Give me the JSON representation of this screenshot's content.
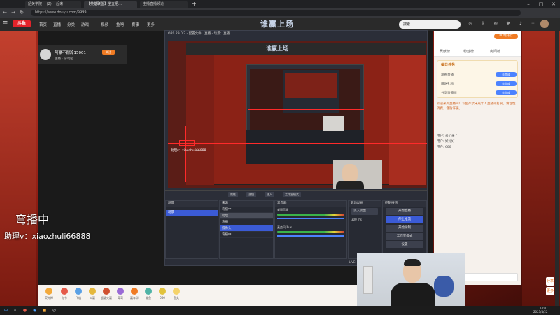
{
  "browser": {
    "tabs": [
      {
        "label": "韶关学院一 (2) 一起来"
      },
      {
        "label": "【英雄联盟】坐五把…"
      },
      {
        "label": "主播直播频道"
      }
    ],
    "url": "https://www.douyu.com/9999"
  },
  "site": {
    "logo": "斗鱼",
    "nav": [
      "首页",
      "直播",
      "分类",
      "游戏",
      "视频",
      "鱼吧",
      "赛事",
      "更多"
    ],
    "brand": "谁赢上场",
    "search_placeholder": "搜索",
    "rank_label": "PC端排行"
  },
  "streamer": {
    "title": "阿豪不耐冷15001",
    "nick": "主播 · 游戏区",
    "follow": "关注",
    "count": "12"
  },
  "overlay": {
    "line1": "弯播中",
    "line2": "助理v：xiaozhuli66888"
  },
  "obs": {
    "title": "OBS 29.0.2 - 配置文件：直播 - 场景：直播",
    "nested_text": "助理v：xiaozhuli66888",
    "toolbar": [
      "属性",
      "滤镜",
      "进入",
      "工作室模式"
    ],
    "docks": {
      "scenes": {
        "header": "场景",
        "items": [
          "场景"
        ]
      },
      "sources": {
        "header": "来源",
        "items": [
          "弯播中",
          "助理",
          "弯播",
          "摄像头",
          "弯播中"
        ]
      },
      "mixer": {
        "header": "混音器",
        "channels": [
          "桌面音频",
          "麦克风/Aux"
        ]
      },
      "transitions": {
        "header": "转场动画",
        "type": "淡入淡出",
        "duration": "300 ms"
      },
      "controls": {
        "header": "控制按钮",
        "buttons": [
          "开始直播",
          "停止推流",
          "开始录制",
          "工作室模式",
          "设置",
          "退出"
        ]
      }
    },
    "status": "LIVE: 00:00:00   REC: 00:00:00   CPU: 12.2%, 30.00 fps"
  },
  "chat": {
    "tabs": [
      "贡献榜",
      "粉丝榜",
      "房间榜"
    ],
    "task_title": "每日任务",
    "tasks": [
      {
        "label": "观看直播",
        "btn": "去完成"
      },
      {
        "label": "赠送礼物",
        "btn": "去完成"
      },
      {
        "label": "分享直播间",
        "btn": "去完成"
      }
    ],
    "messages": [
      "欢迎来到直播间！斗鱼严禁未成年人直播或打赏，请理性消费，谨防诈骗。",
      "用户: 来了来了",
      "用户: 好好好",
      "用户: 666"
    ],
    "side_buttons": [
      "分享",
      "更多"
    ]
  },
  "gifts": [
    "荧光棒",
    "办卡",
    "飞机",
    "火箭",
    "超级火箭",
    "弯弯",
    "嘉年华",
    "鲸鱼",
    "666",
    "鱼丸",
    "点赞",
    "告白"
  ],
  "taskbar": {
    "time": "14:07",
    "date": "2023/4/22"
  }
}
